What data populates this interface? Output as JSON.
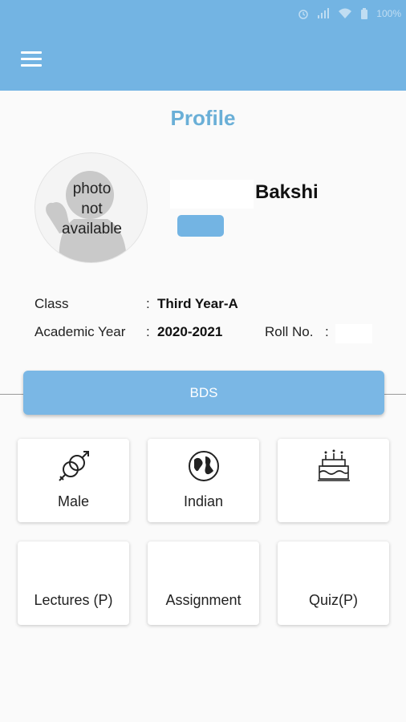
{
  "status_bar": {
    "battery": "100%"
  },
  "page": {
    "title": "Profile"
  },
  "profile": {
    "photo_text": [
      "photo",
      "not",
      "available"
    ],
    "surname": "Bakshi"
  },
  "info": {
    "class_label": "Class",
    "class_value": "Third Year-A",
    "year_label": "Academic Year",
    "year_value": "2020-2021",
    "roll_label": "Roll No.",
    "colon": ":"
  },
  "course": {
    "label": "BDS"
  },
  "tiles": [
    {
      "label": "Male",
      "icon": "gender-icon"
    },
    {
      "label": "Indian",
      "icon": "globe-icon"
    },
    {
      "label": "",
      "icon": "birthday-cake-icon"
    },
    {
      "label": "Lectures (P)"
    },
    {
      "label": "Assignment"
    },
    {
      "label": "Quiz(P)"
    }
  ],
  "colors": {
    "primary": "#73b4e3",
    "title": "#6aafd7",
    "background": "#fafafa"
  }
}
